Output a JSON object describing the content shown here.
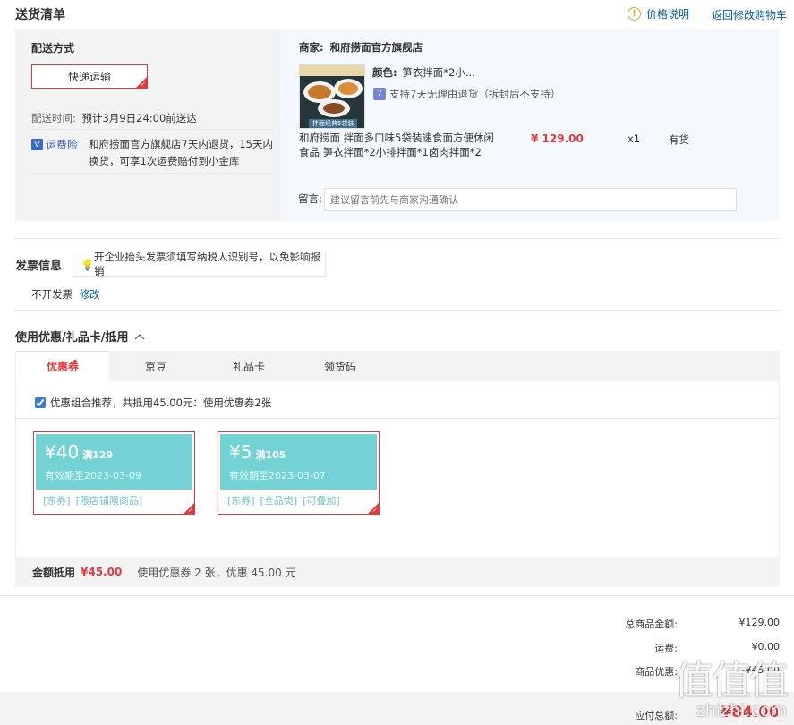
{
  "delivery": {
    "title": "送货清单",
    "price_info_link": "价格说明",
    "back_to_cart_link": "返回修改购物车",
    "shipping_method_label": "配送方式",
    "shipping_method_value": "快递运输",
    "delivery_time_label": "配送时间:",
    "delivery_time_value": "预计3月9日24:00前送达",
    "insurance_label": "运费险",
    "insurance_desc": "和府捞面官方旗舰店7天内退货，15天内换货，可享1次运费赔付到小金库",
    "merchant_label": "商家:",
    "merchant_name": "和府捞面官方旗舰店",
    "product": {
      "color_label": "颜色:",
      "color_value": "笋衣拌面*2小...",
      "return_policy": "支持7天无理由退货（拆封后不支持）",
      "name": "和府捞面 拌面多口味5袋装速食面方便休闲食品 笋衣拌面*2小排拌面*1卤肉拌面*2",
      "price": "¥ 129.00",
      "quantity": "x1",
      "stock": "有货",
      "image_caption": "拌面经典5袋装"
    },
    "message_label": "留言:",
    "message_placeholder": "建议留言前先与商家沟通确认"
  },
  "invoice": {
    "title": "发票信息",
    "tip": "开企业抬头发票须填写纳税人识别号，以免影响报销",
    "status": "不开发票",
    "edit_link": "修改"
  },
  "coupons": {
    "title": "使用优惠/礼品卡/抵用",
    "tabs": [
      "优惠券",
      "京豆",
      "礼品卡",
      "领货码"
    ],
    "recommend_text": "优惠组合推荐，共抵用45.00元：使用优惠券2张",
    "cards": [
      {
        "amount": "¥40",
        "condition": "满129",
        "expiry": "有效期至2023-03-09",
        "tags": [
          "[东券]",
          "[限店铺限商品]"
        ]
      },
      {
        "amount": "¥5",
        "condition": "满105",
        "expiry": "有效期至2023-03-07",
        "tags": [
          "[东券]",
          "[全品类]",
          "[可叠加]"
        ]
      }
    ],
    "summary_label": "金额抵用",
    "summary_amount": "¥45.00",
    "summary_desc": "使用优惠券 2 张，优惠 45.00 元"
  },
  "totals": {
    "items_label": "总商品金额:",
    "items_value": "¥129.00",
    "shipping_label": "运费:",
    "shipping_value": "¥0.00",
    "discount_label": "商品优惠:",
    "discount_value": "-¥45.00",
    "payable_label": "应付总额:",
    "payable_value": "¥84.00"
  },
  "watermark": {
    "glyphs": "值值值",
    "site": "zhizhi.com"
  },
  "colors": {
    "accent_red": "#e4393c",
    "link_blue": "#005aa0",
    "coupon_teal": "#73d2d4"
  }
}
